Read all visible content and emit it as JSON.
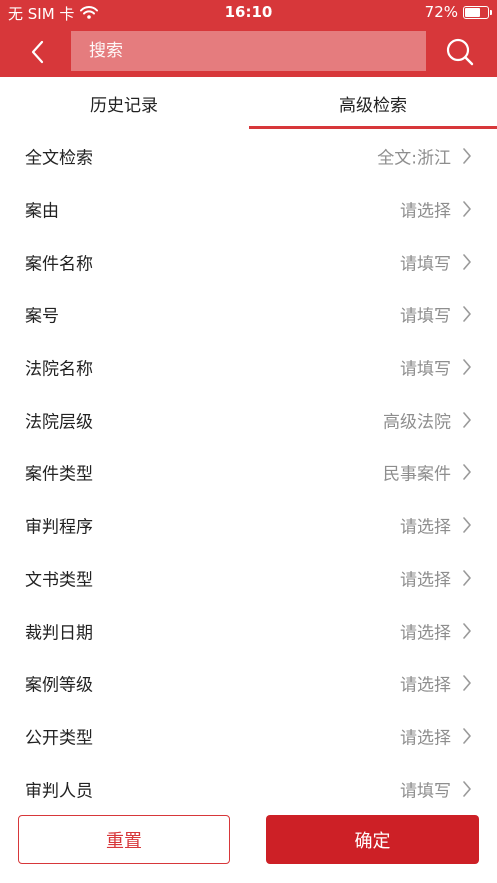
{
  "status_bar": {
    "carrier": "无 SIM 卡",
    "time": "16:10",
    "battery_text": "72%",
    "battery_level": 0.72
  },
  "nav": {
    "search_placeholder": "搜索"
  },
  "tabs": [
    {
      "label": "历史记录",
      "active": false
    },
    {
      "label": "高级检索",
      "active": true
    }
  ],
  "fields": [
    {
      "label": "全文检索",
      "value": "全文:浙江"
    },
    {
      "label": "案由",
      "value": "请选择"
    },
    {
      "label": "案件名称",
      "value": "请填写"
    },
    {
      "label": "案号",
      "value": "请填写"
    },
    {
      "label": "法院名称",
      "value": "请填写"
    },
    {
      "label": "法院层级",
      "value": "高级法院"
    },
    {
      "label": "案件类型",
      "value": "民事案件"
    },
    {
      "label": "审判程序",
      "value": "请选择"
    },
    {
      "label": "文书类型",
      "value": "请选择"
    },
    {
      "label": "裁判日期",
      "value": "请选择"
    },
    {
      "label": "案例等级",
      "value": "请选择"
    },
    {
      "label": "公开类型",
      "value": "请选择"
    },
    {
      "label": "审判人员",
      "value": "请填写"
    }
  ],
  "actions": {
    "reset_label": "重置",
    "confirm_label": "确定"
  },
  "colors": {
    "brand": "#d7373a",
    "confirm": "#cd2026",
    "value_text": "#8e8e8e"
  }
}
